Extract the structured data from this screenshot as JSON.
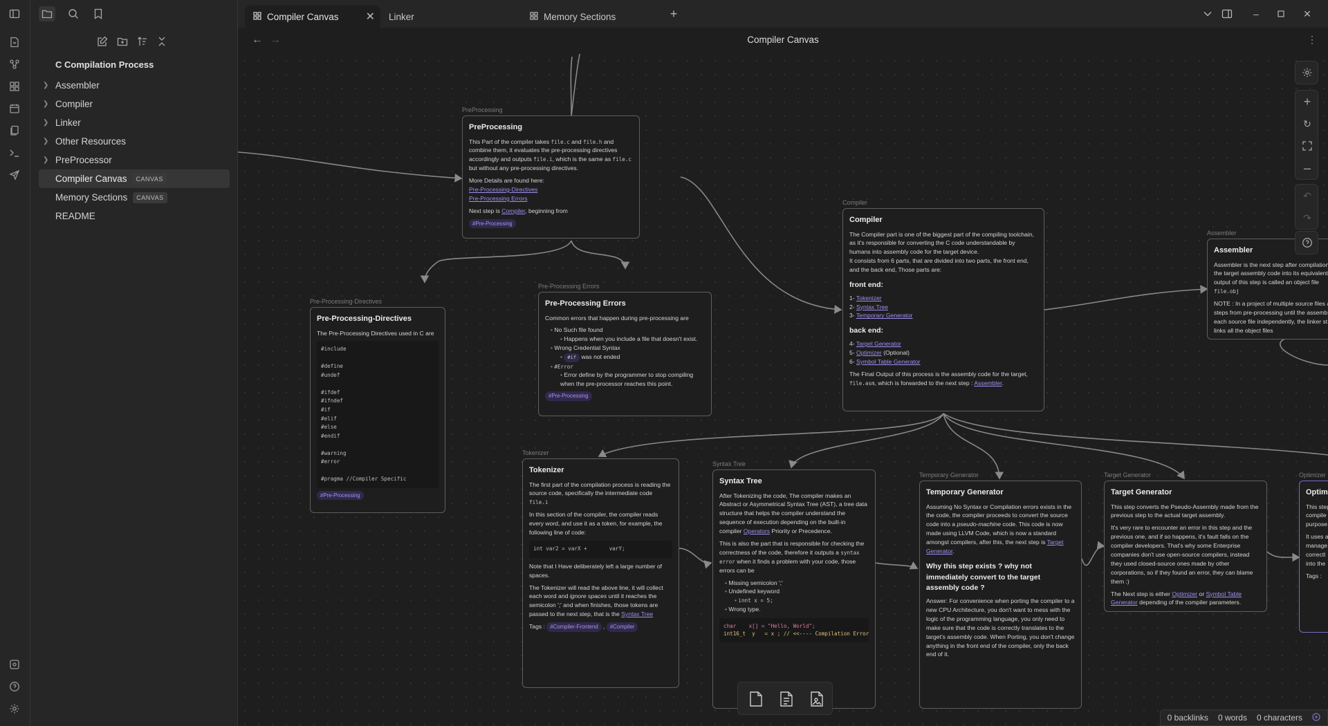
{
  "tabs": [
    {
      "label": "Compiler Canvas",
      "icon": "canvas-icon",
      "active": true
    },
    {
      "label": "Linker",
      "icon": "",
      "active": false
    },
    {
      "label": "Memory Sections",
      "icon": "canvas-icon",
      "active": false
    }
  ],
  "view": {
    "title": "Compiler Canvas"
  },
  "sidebar": {
    "root": "C Compilation Process",
    "items": [
      {
        "label": "Assembler",
        "folder": true
      },
      {
        "label": "Compiler",
        "folder": true
      },
      {
        "label": "Linker",
        "folder": true
      },
      {
        "label": "Other Resources",
        "folder": true
      },
      {
        "label": "PreProcessor",
        "folder": true
      },
      {
        "label": "Compiler Canvas",
        "badge": "CANVAS",
        "active": true
      },
      {
        "label": "Memory Sections",
        "badge": "CANVAS"
      },
      {
        "label": "README"
      }
    ]
  },
  "status": {
    "backlinks": "0 backlinks",
    "words": "0 words",
    "characters": "0 characters"
  },
  "colors": {
    "accent": "#7c6ac7",
    "link": "#a28ff0",
    "bg": "#1e1e1e",
    "panel": "#262626"
  },
  "nodes": {
    "preprocessing": {
      "label": "PreProcessing",
      "title": "PreProcessing",
      "p1a": "This Part of the compiler takes ",
      "c1": "file.c",
      "p1b": " and ",
      "c2": "file.h",
      "p1c": " and combine them, it evaluates the pre-processing directives accordingly and outputs ",
      "c3": "file.i",
      "p1d": ", which is the same as ",
      "c4": "file.c",
      "p1e": " but without any pre-processing directives.",
      "more": "More Details are found here:",
      "link1": "Pre-Processing-Directives",
      "link2": "Pre-Processing Errors",
      "next_a": "Next step is ",
      "next_link": "Compiler",
      "next_b": ", beginning from",
      "tag": "#Pre-Processing"
    },
    "directives": {
      "label": "Pre-Processing-Directives",
      "title": "Pre-Processing-Directives",
      "intro": "The Pre-Processing Directives used in C are",
      "code": "#include\n\n#define\n#undef\n\n#ifdef\n#ifndef\n#if\n#elif\n#else\n#endif\n\n#warning\n#error\n\n#pragma //Compiler Specific",
      "tag": "#Pre-Processing"
    },
    "errors": {
      "label": "Pre-Processing Errors",
      "title": "Pre-Processing Errors",
      "intro": "Common errors that happen during pre-processing are",
      "e1": "No Such file found",
      "e1a": "Happens when you include a file that doesn't exist.",
      "e2": "Wrong Credential Syntax",
      "e2code": "#if",
      "e2a": " was not ended",
      "e3": "#Error",
      "e3a": "Error define by the programmer to stop compiling when the pre-processor reaches this point.",
      "tag": "#Pre-Processing"
    },
    "compiler": {
      "label": "Compiler",
      "title": "Compiler",
      "p1": "The Compiler part is one of the biggest part of the compiling toolchain, as it's responsible for converting the C code understandable by humans into assembly code for the target device.",
      "p2": "It consists from 6 parts, that are divided into two parts, the front end, and the back end, Those parts are:",
      "front": "front end:",
      "f1n": "1- ",
      "f1": "Tokenizer",
      "f2n": "2- ",
      "f2": "Syntax Tree",
      "f3n": "3- ",
      "f3": "Temporary Generator",
      "back": "back end:",
      "b4n": "4- ",
      "b4": "Target Generator",
      "b5n": "5- ",
      "b5": "Optimizer",
      "b5s": " (Optional)",
      "b6n": "6- ",
      "b6": "Symbol Table Generator",
      "final_a": "The Final Output of this process is the assembly code for the target, ",
      "final_code": "file.asm",
      "final_b": ", which is forwarded to the next step : ",
      "final_link": "Assembler",
      "final_c": "."
    },
    "assembler": {
      "label": "Assembler",
      "title": "Assembler",
      "p1a": "Assembler is the next step after compilation, the target assembly code into its equivalent output of this step is called an object file ",
      "p1code": "file.obj",
      "p2": "NOTE : In a project of multiple source files a steps from pre-processing until the assemb each source file independently, the linker st links all the object files"
    },
    "tokenizer": {
      "label": "Tokenizer",
      "title": "Tokenizer",
      "p1": "The first part of the compilation process is reading the source code, specifically the intermediate code",
      "p1code": "file.i",
      "p2": "In this section of the compiler, the compiler reads every word, and use it as a token, for example, the following line of code:",
      "code": "int var2 = varX +       varY;",
      "p3": "Note that I Have deliberately left a large number of spaces.",
      "p4a": "The Tokenizer will read the above line, it will collect each word and ",
      "p4i": "ignore spaces",
      "p4b": " until it reaches the semicolon ';' and when finishes, those tokens are passed to the next step, that is the ",
      "p4link": "Syntax Tree",
      "tags_label": "Tags : ",
      "tag1": "#Compiler-Frontend",
      "tag2": "#Compiler"
    },
    "syntax": {
      "label": "Syntax Tree",
      "title": "Syntax Tree",
      "p1a": "After Tokenizing the code, The compiler makes an Abstract or Asymmetrical Syntax Tree (AST), a tree data structure that helps the compiler understand the sequence of execution depending on the built-in compiler ",
      "p1link": "Operators",
      "p1b": " Priority or Precedence.",
      "p2a": "This is also the part that is responsible for checking the correctness of the code, therefore it outputs a ",
      "p2code": "syntax error",
      "p2b": " when it finds a problem with your code, those errors can be",
      "e1": "Missing semicolon ';'",
      "e2": "Undefined keyword",
      "e2code": "innt x = 5;",
      "e3": "Wrong type.",
      "code1": "char    x[] = \"Hello, World\";",
      "code2": "int16_t  y   = x ; // <<---- Compilation Error"
    },
    "temporary": {
      "label": "Temporary Generator",
      "title": "Temporary Generator",
      "p1a": "Assuming No Syntax or Compilation errors exists in the the code, the compiler proceeds to convert the source code into a ",
      "p1i": "pseudo-machine",
      "p1b": " code. This code is now made using LLVM Code, which is now a standard amongst compilers, after this, the next step is ",
      "p1link": "Target Generator",
      "p1c": ".",
      "h2": "Why this step exists ? why not immediately convert to the target assembly code ?",
      "p2": "Answer: For convenience when porting the compiler to a new CPU Architecture, you don't want to mess with the logic of the programming language, you only need to make sure that the code is correctly translates to the target's assembly code. When Porting, you don't change anything in the front end of the compiler, only the back end of it."
    },
    "target": {
      "label": "Target Generator",
      "title": "Target Generator",
      "p1": "This step converts the Pseudo-Assembly made from the previous step to the actual target assembly.",
      "p2": "It's very rare to encounter an error in this step and the previous one, and if so happens, it's fault falls on the compiler developers. That's why some Enterprise companies don't use open-source compilers, instead they used closed-source ones made by other corporations, so if they found an error, they can blame them :)",
      "p3a": "The Next step is either ",
      "p3l1": "Optimizer",
      "p3b": " or ",
      "p3l2": "Symbol Table Generator",
      "p3c": " depending of the compiler parameters."
    },
    "optimizer": {
      "label": "Optimizer",
      "title": "Optim",
      "p1": "This step compile purpose",
      "p2": "It uses a manage correctl into the",
      "tags": "Tags :"
    }
  }
}
